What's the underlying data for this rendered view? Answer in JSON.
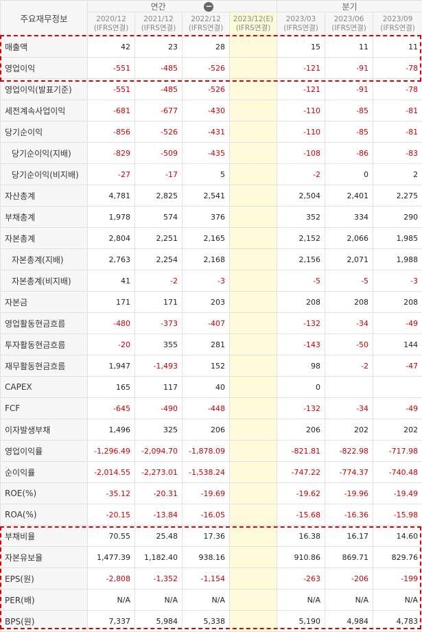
{
  "header": {
    "corner_label": "주요재무정보",
    "group_annual": "연간",
    "group_quarter": "분기",
    "collapse_icon": "minus-circle-icon",
    "periods": [
      {
        "date": "2020/12",
        "basis": "(IFRS연결)"
      },
      {
        "date": "2021/12",
        "basis": "(IFRS연결)"
      },
      {
        "date": "2022/12",
        "basis": "(IFRS연결)"
      },
      {
        "date": "2023/12(E)",
        "basis": "(IFRS연결)"
      },
      {
        "date": "2023/03",
        "basis": "(IFRS연결)"
      },
      {
        "date": "2023/06",
        "basis": "(IFRS연결)"
      },
      {
        "date": "2023/09",
        "basis": "(IFRS연결)"
      }
    ]
  },
  "colors": {
    "negative": "#cc0000",
    "highlight": "#dd0000",
    "estimate_bg": "#fdfbd9"
  },
  "rows": [
    {
      "label": "매출액",
      "indent": false,
      "values": [
        "42",
        "23",
        "28",
        "",
        "15",
        "11",
        "11"
      ]
    },
    {
      "label": "영업이익",
      "indent": false,
      "values": [
        "-551",
        "-485",
        "-526",
        "",
        "-121",
        "-91",
        "-78"
      ]
    },
    {
      "label": "영업이익(발표기준)",
      "indent": false,
      "values": [
        "-551",
        "-485",
        "-526",
        "",
        "-121",
        "-91",
        "-78"
      ]
    },
    {
      "label": "세전계속사업이익",
      "indent": false,
      "values": [
        "-681",
        "-677",
        "-430",
        "",
        "-110",
        "-85",
        "-81"
      ]
    },
    {
      "label": "당기순이익",
      "indent": false,
      "values": [
        "-856",
        "-526",
        "-431",
        "",
        "-110",
        "-85",
        "-81"
      ]
    },
    {
      "label": "당기순이익(지배)",
      "indent": true,
      "values": [
        "-829",
        "-509",
        "-435",
        "",
        "-108",
        "-86",
        "-83"
      ]
    },
    {
      "label": "당기순이익(비지배)",
      "indent": true,
      "values": [
        "-27",
        "-17",
        "5",
        "",
        "-2",
        "0",
        "2"
      ]
    },
    {
      "label": "자산총계",
      "indent": false,
      "values": [
        "4,781",
        "2,825",
        "2,541",
        "",
        "2,504",
        "2,401",
        "2,275"
      ]
    },
    {
      "label": "부채총계",
      "indent": false,
      "values": [
        "1,978",
        "574",
        "376",
        "",
        "352",
        "334",
        "290"
      ]
    },
    {
      "label": "자본총계",
      "indent": false,
      "values": [
        "2,804",
        "2,251",
        "2,165",
        "",
        "2,152",
        "2,066",
        "1,985"
      ]
    },
    {
      "label": "자본총계(지배)",
      "indent": true,
      "values": [
        "2,763",
        "2,254",
        "2,168",
        "",
        "2,156",
        "2,071",
        "1,988"
      ]
    },
    {
      "label": "자본총계(비지배)",
      "indent": true,
      "values": [
        "41",
        "-2",
        "-3",
        "",
        "-5",
        "-5",
        "-3"
      ]
    },
    {
      "label": "자본금",
      "indent": false,
      "values": [
        "171",
        "171",
        "203",
        "",
        "208",
        "208",
        "208"
      ]
    },
    {
      "label": "영업활동현금흐름",
      "indent": false,
      "values": [
        "-480",
        "-373",
        "-407",
        "",
        "-132",
        "-34",
        "-49"
      ]
    },
    {
      "label": "투자활동현금흐름",
      "indent": false,
      "values": [
        "-20",
        "355",
        "281",
        "",
        "-143",
        "-50",
        "144"
      ]
    },
    {
      "label": "재무활동현금흐름",
      "indent": false,
      "values": [
        "1,947",
        "-1,493",
        "152",
        "",
        "98",
        "-2",
        "-47"
      ]
    },
    {
      "label": "CAPEX",
      "indent": false,
      "values": [
        "165",
        "117",
        "40",
        "",
        "0",
        "",
        ""
      ]
    },
    {
      "label": "FCF",
      "indent": false,
      "values": [
        "-645",
        "-490",
        "-448",
        "",
        "-132",
        "-34",
        "-49"
      ]
    },
    {
      "label": "이자발생부채",
      "indent": false,
      "values": [
        "1,496",
        "325",
        "206",
        "",
        "206",
        "202",
        "202"
      ]
    },
    {
      "label": "영업이익률",
      "indent": false,
      "values": [
        "-1,296.49",
        "-2,094.70",
        "-1,878.09",
        "",
        "-821.81",
        "-822.98",
        "-717.98"
      ]
    },
    {
      "label": "순이익률",
      "indent": false,
      "values": [
        "-2,014.55",
        "-2,273.01",
        "-1,538.24",
        "",
        "-747.22",
        "-774.37",
        "-740.48"
      ]
    },
    {
      "label": "ROE(%)",
      "indent": false,
      "values": [
        "-35.12",
        "-20.31",
        "-19.69",
        "",
        "-19.62",
        "-19.96",
        "-19.49"
      ]
    },
    {
      "label": "ROA(%)",
      "indent": false,
      "values": [
        "-20.15",
        "-13.84",
        "-16.05",
        "",
        "-15.68",
        "-16.36",
        "-15.98"
      ]
    },
    {
      "label": "부채비율",
      "indent": false,
      "values": [
        "70.55",
        "25.48",
        "17.36",
        "",
        "16.38",
        "16.17",
        "14.60"
      ]
    },
    {
      "label": "자본유보율",
      "indent": false,
      "values": [
        "1,477.39",
        "1,182.40",
        "938.16",
        "",
        "910.86",
        "869.71",
        "829.76"
      ]
    },
    {
      "label": "EPS(원)",
      "indent": false,
      "values": [
        "-2,808",
        "-1,352",
        "-1,154",
        "",
        "-263",
        "-206",
        "-199"
      ]
    },
    {
      "label": "PER(배)",
      "indent": false,
      "values": [
        "N/A",
        "N/A",
        "N/A",
        "",
        "N/A",
        "N/A",
        "N/A"
      ]
    },
    {
      "label": "BPS(원)",
      "indent": false,
      "values": [
        "7,337",
        "5,984",
        "5,338",
        "",
        "5,190",
        "4,984",
        "4,783"
      ]
    }
  ]
}
